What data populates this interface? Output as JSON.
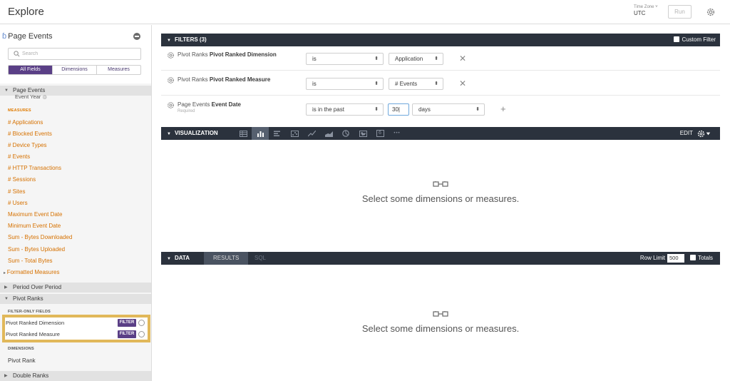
{
  "header": {
    "title": "Explore",
    "timezone_label": "Time Zone",
    "timezone_value": "UTC",
    "run_label": "Run"
  },
  "sidebar": {
    "title": "Page Events",
    "search_placeholder": "Search",
    "tabs": [
      "All Fields",
      "Dimensions",
      "Measures"
    ],
    "view_name": "Page Events",
    "event_year": "Event Year",
    "measures_label": "MEASURES",
    "measures": [
      "# Applications",
      "# Blocked Events",
      "# Device Types",
      "# Events",
      "# HTTP Transactions",
      "# Sessions",
      "# Sites",
      "# Users",
      "Maximum Event Date",
      "Minimum Event Date",
      "Sum - Bytes Downloaded",
      "Sum - Bytes Uploaded",
      "Sum - Total Bytes"
    ],
    "formatted_measures": "Formatted Measures",
    "period_over_period": "Period Over Period",
    "pivot_ranks": "Pivot Ranks",
    "filter_only_label": "FILTER-ONLY FIELDS",
    "filter_only_fields": [
      "Pivot Ranked Dimension",
      "Pivot Ranked Measure"
    ],
    "filter_tag": "FILTER",
    "dimensions_label": "DIMENSIONS",
    "pivot_rank": "Pivot Rank",
    "double_ranks": "Double Ranks"
  },
  "filters": {
    "header": "FILTERS (3)",
    "custom_filter_label": "Custom Filter",
    "rows": [
      {
        "prefix": "Pivot Ranks",
        "field": "Pivot Ranked Dimension",
        "operator": "is",
        "value": "Application"
      },
      {
        "prefix": "Pivot Ranks",
        "field": "Pivot Ranked Measure",
        "operator": "is",
        "value": "# Events"
      },
      {
        "prefix": "Page Events",
        "field": "Event Date",
        "required": "Required",
        "operator": "is in the past",
        "value": "30",
        "unit": "days"
      }
    ]
  },
  "visualization": {
    "header": "VISUALIZATION",
    "edit_label": "EDIT",
    "icons": [
      "table-icon",
      "column-chart-icon",
      "bar-chart-icon",
      "scatter-icon",
      "line-chart-icon",
      "area-chart-icon",
      "pie-chart-icon",
      "map-icon",
      "single-value-icon",
      "more-icon"
    ],
    "single_value_glyph": "6",
    "more_glyph": "•••",
    "empty_message": "Select some dimensions or measures."
  },
  "data": {
    "header": "DATA",
    "tabs": [
      "RESULTS",
      "SQL"
    ],
    "row_limit_label": "Row Limit",
    "row_limit_value": "500",
    "totals_label": "Totals",
    "empty_message": "Select some dimensions or measures."
  },
  "colors": {
    "accent_purple": "#5a3f86",
    "measure_orange": "#d67100",
    "dark_bar": "#2b323d",
    "highlight": "#e1b85a"
  }
}
